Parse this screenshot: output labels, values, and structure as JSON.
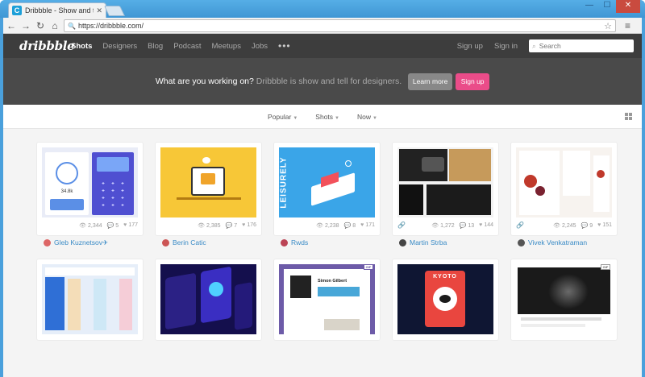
{
  "browser": {
    "tab_title": "Dribbble - Show and tell ...",
    "url": "https://dribbble.com/"
  },
  "nav": {
    "logo": "dribbble",
    "links": [
      "Shots",
      "Designers",
      "Blog",
      "Podcast",
      "Meetups",
      "Jobs"
    ],
    "more": "•••",
    "signup": "Sign up",
    "signin": "Sign in",
    "search_placeholder": "Search"
  },
  "hero": {
    "lead": "What are you working on?",
    "rest": "Dribbble is show and tell for designers.",
    "learn_more": "Learn more",
    "signup": "Sign up"
  },
  "filters": [
    "Popular",
    "Shots",
    "Now"
  ],
  "shots_row1": [
    {
      "views": "2,344",
      "comments": "5",
      "likes": "177",
      "author": "Gleb Kuznetsov✈"
    },
    {
      "views": "2,385",
      "comments": "7",
      "likes": "176",
      "author": "Berin Catic"
    },
    {
      "views": "2,238",
      "comments": "8",
      "likes": "171",
      "author": "Rwds"
    },
    {
      "views": "1,272",
      "comments": "13",
      "likes": "144",
      "author": "Martin Strba"
    },
    {
      "views": "2,245",
      "comments": "9",
      "likes": "151",
      "author": "Vivek Venkatraman"
    }
  ],
  "thumb_text": {
    "leisurely": "LEISURELY",
    "simon": "Simon Gilbert",
    "kyoto": "KYOTO",
    "gif": "GIF",
    "big_value": "34.8k"
  },
  "colors": {
    "nav_bg": "#3d3d3d",
    "hero_bg": "#4a4a4a",
    "pink": "#ea4c89",
    "link": "#3a8bc6"
  }
}
